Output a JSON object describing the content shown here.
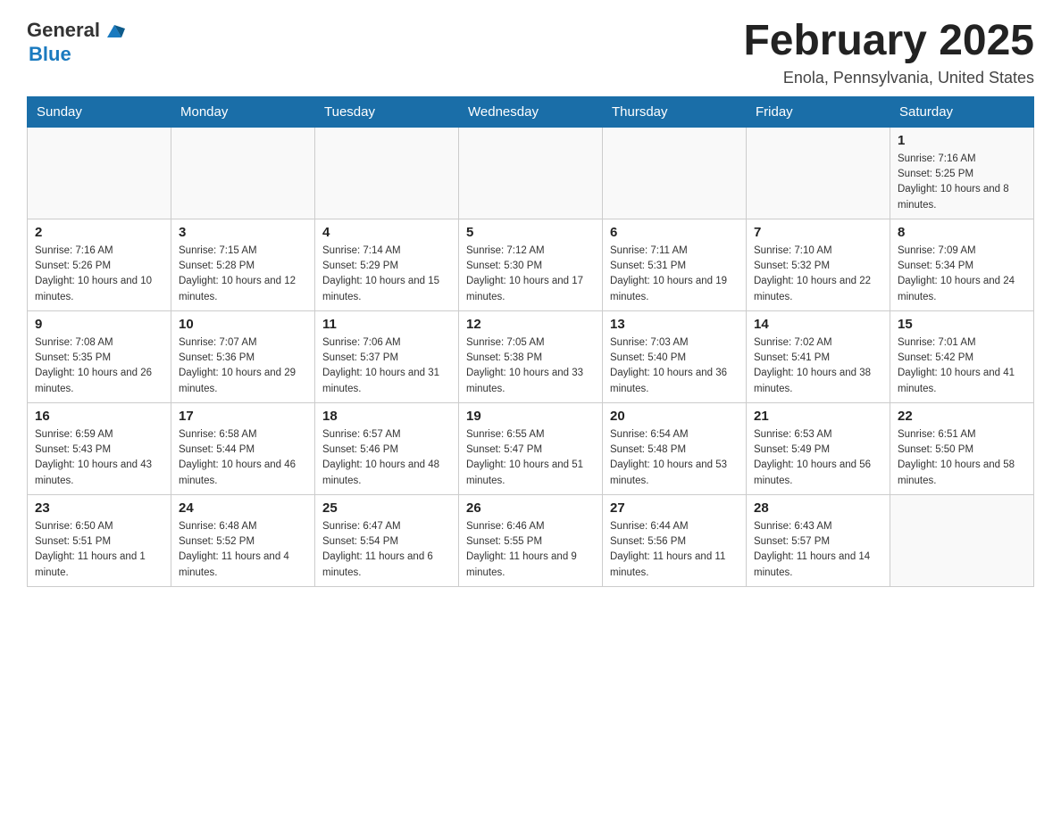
{
  "header": {
    "logo": {
      "general": "General",
      "blue": "Blue",
      "arrow_color": "#1a7abf"
    },
    "title": "February 2025",
    "location": "Enola, Pennsylvania, United States"
  },
  "days_of_week": [
    "Sunday",
    "Monday",
    "Tuesday",
    "Wednesday",
    "Thursday",
    "Friday",
    "Saturday"
  ],
  "weeks": [
    {
      "cells": [
        {
          "day": "",
          "info": ""
        },
        {
          "day": "",
          "info": ""
        },
        {
          "day": "",
          "info": ""
        },
        {
          "day": "",
          "info": ""
        },
        {
          "day": "",
          "info": ""
        },
        {
          "day": "",
          "info": ""
        },
        {
          "day": "1",
          "info": "Sunrise: 7:16 AM\nSunset: 5:25 PM\nDaylight: 10 hours and 8 minutes."
        }
      ]
    },
    {
      "cells": [
        {
          "day": "2",
          "info": "Sunrise: 7:16 AM\nSunset: 5:26 PM\nDaylight: 10 hours and 10 minutes."
        },
        {
          "day": "3",
          "info": "Sunrise: 7:15 AM\nSunset: 5:28 PM\nDaylight: 10 hours and 12 minutes."
        },
        {
          "day": "4",
          "info": "Sunrise: 7:14 AM\nSunset: 5:29 PM\nDaylight: 10 hours and 15 minutes."
        },
        {
          "day": "5",
          "info": "Sunrise: 7:12 AM\nSunset: 5:30 PM\nDaylight: 10 hours and 17 minutes."
        },
        {
          "day": "6",
          "info": "Sunrise: 7:11 AM\nSunset: 5:31 PM\nDaylight: 10 hours and 19 minutes."
        },
        {
          "day": "7",
          "info": "Sunrise: 7:10 AM\nSunset: 5:32 PM\nDaylight: 10 hours and 22 minutes."
        },
        {
          "day": "8",
          "info": "Sunrise: 7:09 AM\nSunset: 5:34 PM\nDaylight: 10 hours and 24 minutes."
        }
      ]
    },
    {
      "cells": [
        {
          "day": "9",
          "info": "Sunrise: 7:08 AM\nSunset: 5:35 PM\nDaylight: 10 hours and 26 minutes."
        },
        {
          "day": "10",
          "info": "Sunrise: 7:07 AM\nSunset: 5:36 PM\nDaylight: 10 hours and 29 minutes."
        },
        {
          "day": "11",
          "info": "Sunrise: 7:06 AM\nSunset: 5:37 PM\nDaylight: 10 hours and 31 minutes."
        },
        {
          "day": "12",
          "info": "Sunrise: 7:05 AM\nSunset: 5:38 PM\nDaylight: 10 hours and 33 minutes."
        },
        {
          "day": "13",
          "info": "Sunrise: 7:03 AM\nSunset: 5:40 PM\nDaylight: 10 hours and 36 minutes."
        },
        {
          "day": "14",
          "info": "Sunrise: 7:02 AM\nSunset: 5:41 PM\nDaylight: 10 hours and 38 minutes."
        },
        {
          "day": "15",
          "info": "Sunrise: 7:01 AM\nSunset: 5:42 PM\nDaylight: 10 hours and 41 minutes."
        }
      ]
    },
    {
      "cells": [
        {
          "day": "16",
          "info": "Sunrise: 6:59 AM\nSunset: 5:43 PM\nDaylight: 10 hours and 43 minutes."
        },
        {
          "day": "17",
          "info": "Sunrise: 6:58 AM\nSunset: 5:44 PM\nDaylight: 10 hours and 46 minutes."
        },
        {
          "day": "18",
          "info": "Sunrise: 6:57 AM\nSunset: 5:46 PM\nDaylight: 10 hours and 48 minutes."
        },
        {
          "day": "19",
          "info": "Sunrise: 6:55 AM\nSunset: 5:47 PM\nDaylight: 10 hours and 51 minutes."
        },
        {
          "day": "20",
          "info": "Sunrise: 6:54 AM\nSunset: 5:48 PM\nDaylight: 10 hours and 53 minutes."
        },
        {
          "day": "21",
          "info": "Sunrise: 6:53 AM\nSunset: 5:49 PM\nDaylight: 10 hours and 56 minutes."
        },
        {
          "day": "22",
          "info": "Sunrise: 6:51 AM\nSunset: 5:50 PM\nDaylight: 10 hours and 58 minutes."
        }
      ]
    },
    {
      "cells": [
        {
          "day": "23",
          "info": "Sunrise: 6:50 AM\nSunset: 5:51 PM\nDaylight: 11 hours and 1 minute."
        },
        {
          "day": "24",
          "info": "Sunrise: 6:48 AM\nSunset: 5:52 PM\nDaylight: 11 hours and 4 minutes."
        },
        {
          "day": "25",
          "info": "Sunrise: 6:47 AM\nSunset: 5:54 PM\nDaylight: 11 hours and 6 minutes."
        },
        {
          "day": "26",
          "info": "Sunrise: 6:46 AM\nSunset: 5:55 PM\nDaylight: 11 hours and 9 minutes."
        },
        {
          "day": "27",
          "info": "Sunrise: 6:44 AM\nSunset: 5:56 PM\nDaylight: 11 hours and 11 minutes."
        },
        {
          "day": "28",
          "info": "Sunrise: 6:43 AM\nSunset: 5:57 PM\nDaylight: 11 hours and 14 minutes."
        },
        {
          "day": "",
          "info": ""
        }
      ]
    }
  ]
}
